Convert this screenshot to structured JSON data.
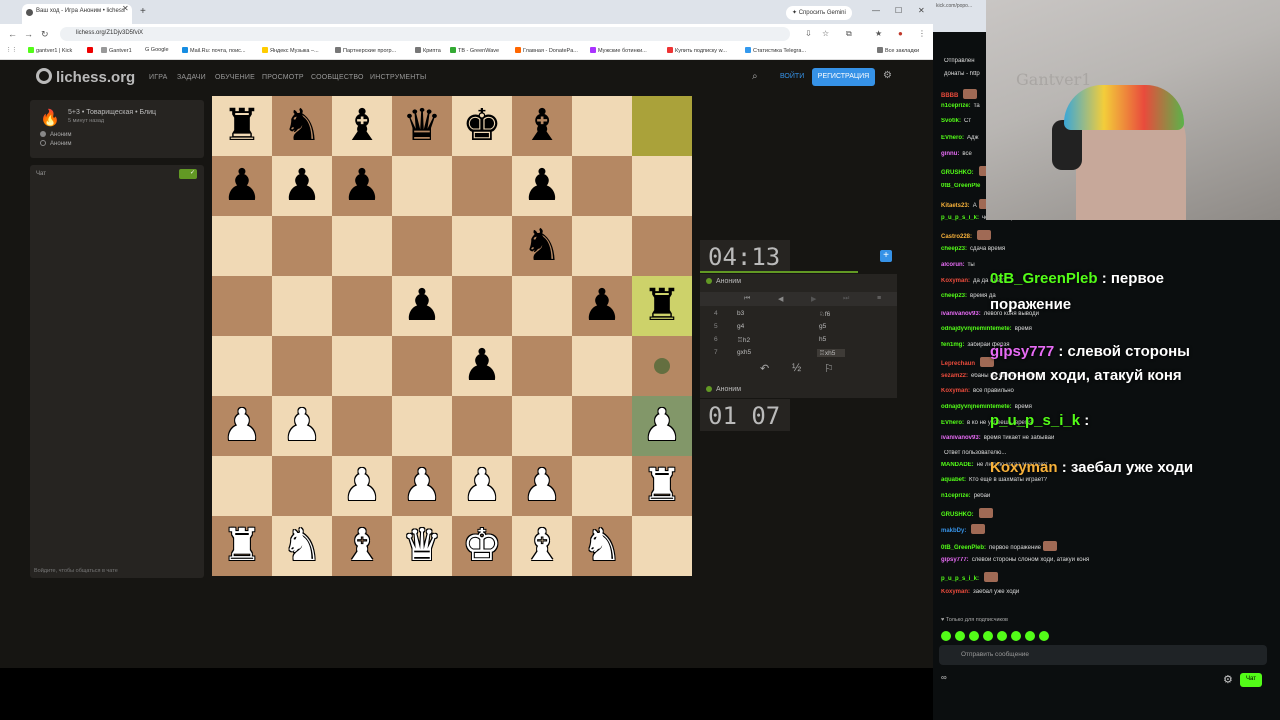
{
  "browser": {
    "tab_title": "Ваш ход - Игра Аноним • lichess",
    "gemini": "✦ Спросить Gemini",
    "url": "lichess.org/Z1Djv3D5fviX",
    "bookmarks": [
      "gantver1 | Kick",
      "",
      "Gantver1",
      "G Google",
      "Mail.Ru: почта, поис...",
      "Яндекс Музыка –...",
      "Партнерские прогр...",
      "Крипта",
      "TB - GreenWave",
      "Главная - DonatePa...",
      "Мужские ботинки...",
      "Купить подписку w...",
      "Статистика Telegra...",
      "Все закладки"
    ]
  },
  "lichess": {
    "logo": "lichess.org",
    "nav": [
      "ИГРА",
      "ЗАДАЧИ",
      "ОБУЧЕНИЕ",
      "ПРОСМОТР",
      "СООБЩЕСТВО",
      "ИНСТРУМЕНТЫ"
    ],
    "signin": "ВОЙТИ",
    "register": "РЕГИСТРАЦИЯ",
    "game_title": "5+3 • Товарищеская • Блиц",
    "game_time": "5 минут назад",
    "player1": "Аноним",
    "player2": "Аноним",
    "chat_label": "Чат",
    "chat_placeholder": "Войдите, чтобы общаться в чате",
    "clock_top": "04:13",
    "clock_bottom": "01 07",
    "opponent": "Аноним",
    "me": "Аноним",
    "moves": [
      {
        "n": "4",
        "w": "b3",
        "b": "♘f6"
      },
      {
        "n": "5",
        "w": "g4",
        "b": "g5"
      },
      {
        "n": "6",
        "w": "♖h2",
        "b": "h5"
      },
      {
        "n": "7",
        "w": "gxh5",
        "b": "♖xh5"
      }
    ],
    "draw": "½"
  },
  "kick": {
    "tab_url": "kick.com/popo...",
    "wall_text": "Gantver1",
    "chat": [
      {
        "name": "",
        "color": "#aaa",
        "text": "Отправлен"
      },
      {
        "name": "",
        "color": "#aaa",
        "text": "донаты - http"
      },
      {
        "name": "BBBB",
        "color": "#e94b3c",
        "text": ""
      },
      {
        "name": "n1ceprize:",
        "color": "#53fc18",
        "text": "та"
      },
      {
        "name": "Svotik:",
        "color": "#53fc18",
        "text": "Ст"
      },
      {
        "name": "EVhero:",
        "color": "#53fc18",
        "text": "Адж"
      },
      {
        "name": "ginnu:",
        "color": "#e86cf6",
        "text": "все"
      },
      {
        "name": "GRUSHKO:",
        "color": "#53fc18",
        "text": ""
      },
      {
        "name": "0tB_GreenPle",
        "color": "#53fc18",
        "text": ""
      },
      {
        "name": "Kitaets23:",
        "color": "#f7b13a",
        "text": "А"
      },
      {
        "name": "p_u_p_s_i_k:",
        "color": "#53fc18",
        "text": "чек и смотрим"
      },
      {
        "name": "Castro228:",
        "color": "#f7b13a",
        "text": ""
      },
      {
        "name": "cheep23:",
        "color": "#53fc18",
        "text": "сдача время"
      },
      {
        "name": "alcorun:",
        "color": "#e86cf6",
        "text": "ты"
      },
      {
        "name": "Koxyman:",
        "color": "#e94b3c",
        "text": "да да съест"
      },
      {
        "name": "cheep23:",
        "color": "#53fc18",
        "text": "время да"
      },
      {
        "name": "ivanivanov93:",
        "color": "#e86cf6",
        "text": "левого коня выводи"
      },
      {
        "name": "odnajdyvnjnemintemete:",
        "color": "#53fc18",
        "text": "время"
      },
      {
        "name": "fen1mg:",
        "color": "#53fc18",
        "text": "забирай ферзя"
      },
      {
        "name": "Leprechaun",
        "color": "#e94b3c",
        "text": ""
      },
      {
        "name": "sezam22:",
        "color": "#e94b3c",
        "text": "ебаны ты гомункул время"
      },
      {
        "name": "Koxyman:",
        "color": "#e94b3c",
        "text": "всё правильно"
      },
      {
        "name": "odnajdyvnjnemintemete:",
        "color": "#53fc18",
        "text": "время"
      },
      {
        "name": "EVhero:",
        "color": "#53fc18",
        "text": "в ко не успеешь, время"
      },
      {
        "name": "ivanivanov93:",
        "color": "#e86cf6",
        "text": "время тикает не забывай"
      },
      {
        "name": "",
        "color": "#aaa",
        "text": "Ответ пользователю..."
      },
      {
        "name": "MANDADE:",
        "color": "#53fc18",
        "text": "не люблю когда мухлюют"
      },
      {
        "name": "aquabet:",
        "color": "#53fc18",
        "text": "Кто ещё в шахматы играет?"
      },
      {
        "name": "n1ceprize:",
        "color": "#53fc18",
        "text": "ребай"
      },
      {
        "name": "GRUSHKO:",
        "color": "#53fc18",
        "text": ""
      },
      {
        "name": "makbDy:",
        "color": "#3692e7",
        "text": ""
      },
      {
        "name": "0tB_GreenPleb:",
        "color": "#53fc18",
        "text": "первое поражение"
      },
      {
        "name": "gipsy777:",
        "color": "#e86cf6",
        "text": "слевой стороны слоном ходи, атакуй коня"
      },
      {
        "name": "p_u_p_s_i_k:",
        "color": "#53fc18",
        "text": ""
      },
      {
        "name": "Koxyman:",
        "color": "#e94b3c",
        "text": "заебал уже ходи"
      }
    ],
    "overlays": [
      {
        "name": "0tB_GreenPleb",
        "color": "#53fc18",
        "text": " : первое",
        "line2": "поражение"
      },
      {
        "name": "gipsy777",
        "color": "#e86cf6",
        "text": " : слевой стороны",
        "line2": "слоном ходи, атакуй коня"
      },
      {
        "name": "p_u_p_s_i_k",
        "color": "#53fc18",
        "text": " :",
        "line2": ""
      },
      {
        "name": "Koxyman",
        "color": "#f7b13a",
        "text": " : заебал уже ходи",
        "line2": ""
      }
    ],
    "sub_only": "♥ Только для подписчиков",
    "input_placeholder": "Отправить сообщение",
    "chat_button": "Чат",
    "infinity": "∞"
  }
}
